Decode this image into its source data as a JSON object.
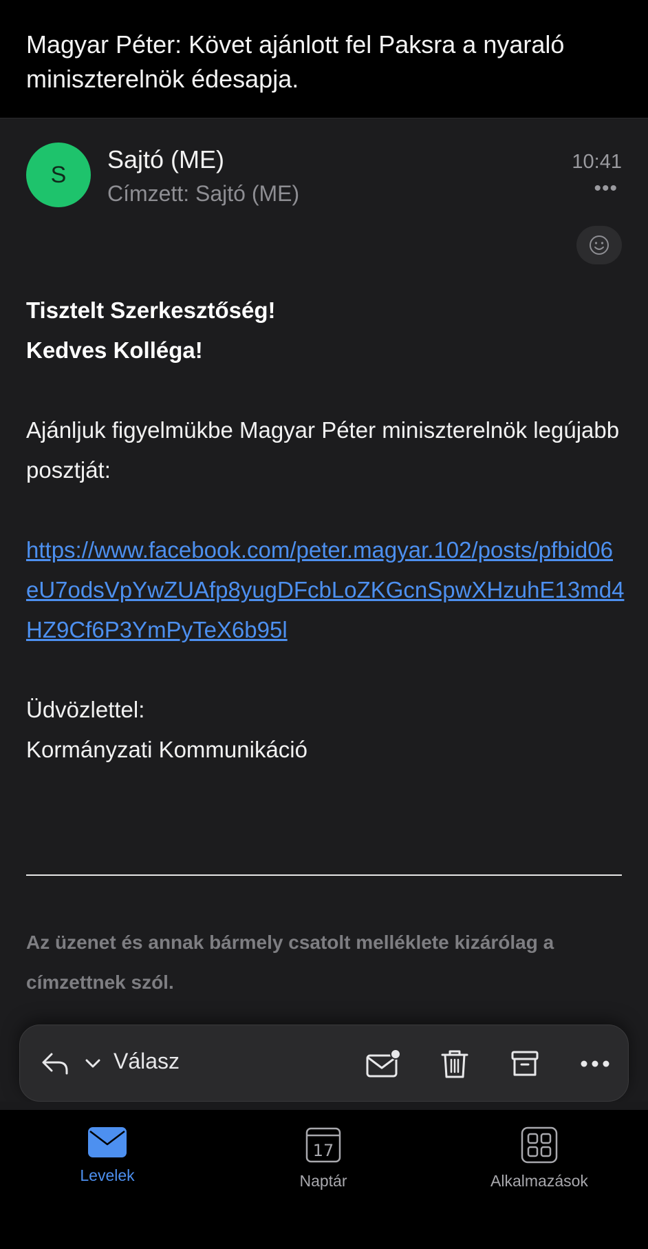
{
  "header": {
    "subject": "Magyar Péter: Követ ajánlott fel Paksra a nyaraló miniszterelnök édesapja."
  },
  "sender": {
    "initial": "S",
    "name": "Sajtó (ME)",
    "recipient": "Címzett: Sajtó (ME)",
    "time": "10:41",
    "more": "•••"
  },
  "body": {
    "greeting1": "Tisztelt Szerkesztőség!",
    "greeting2": "Kedves Kolléga!",
    "paragraph": "Ajánljuk figyelmükbe Magyar Péter miniszterelnök legújabb posztját:",
    "link": "https://www.facebook.com/peter.magyar.102/posts/pfbid06eU7odsVpYwZUAfp8yugDFcbLoZKGcnSpwXHzuhE13md4HZ9Cf6P3YmPyTeX6b95l",
    "closing": "Üdvözlettel:",
    "signature": "Kormányzati Kommunikáció"
  },
  "disclaimer": {
    "text": "Az üzenet és annak bármely csatolt melléklete kizárólag a címzettnek szól."
  },
  "action_bar": {
    "reply_label": "Válasz",
    "icons": [
      "reply-icon",
      "chevron-down-icon",
      "mark-unread-icon",
      "trash-icon",
      "archive-icon",
      "more-icon"
    ]
  },
  "tabs": [
    {
      "label": "Levelek",
      "icon": "mail-icon",
      "active": true
    },
    {
      "label": "Naptár",
      "icon": "calendar-icon",
      "day": "17",
      "active": false
    },
    {
      "label": "Alkalmazások",
      "icon": "apps-grid-icon",
      "active": false
    }
  ],
  "colors": {
    "accent": "#4d90f0",
    "avatar": "#1ec36c",
    "background": "#1c1c1e"
  }
}
